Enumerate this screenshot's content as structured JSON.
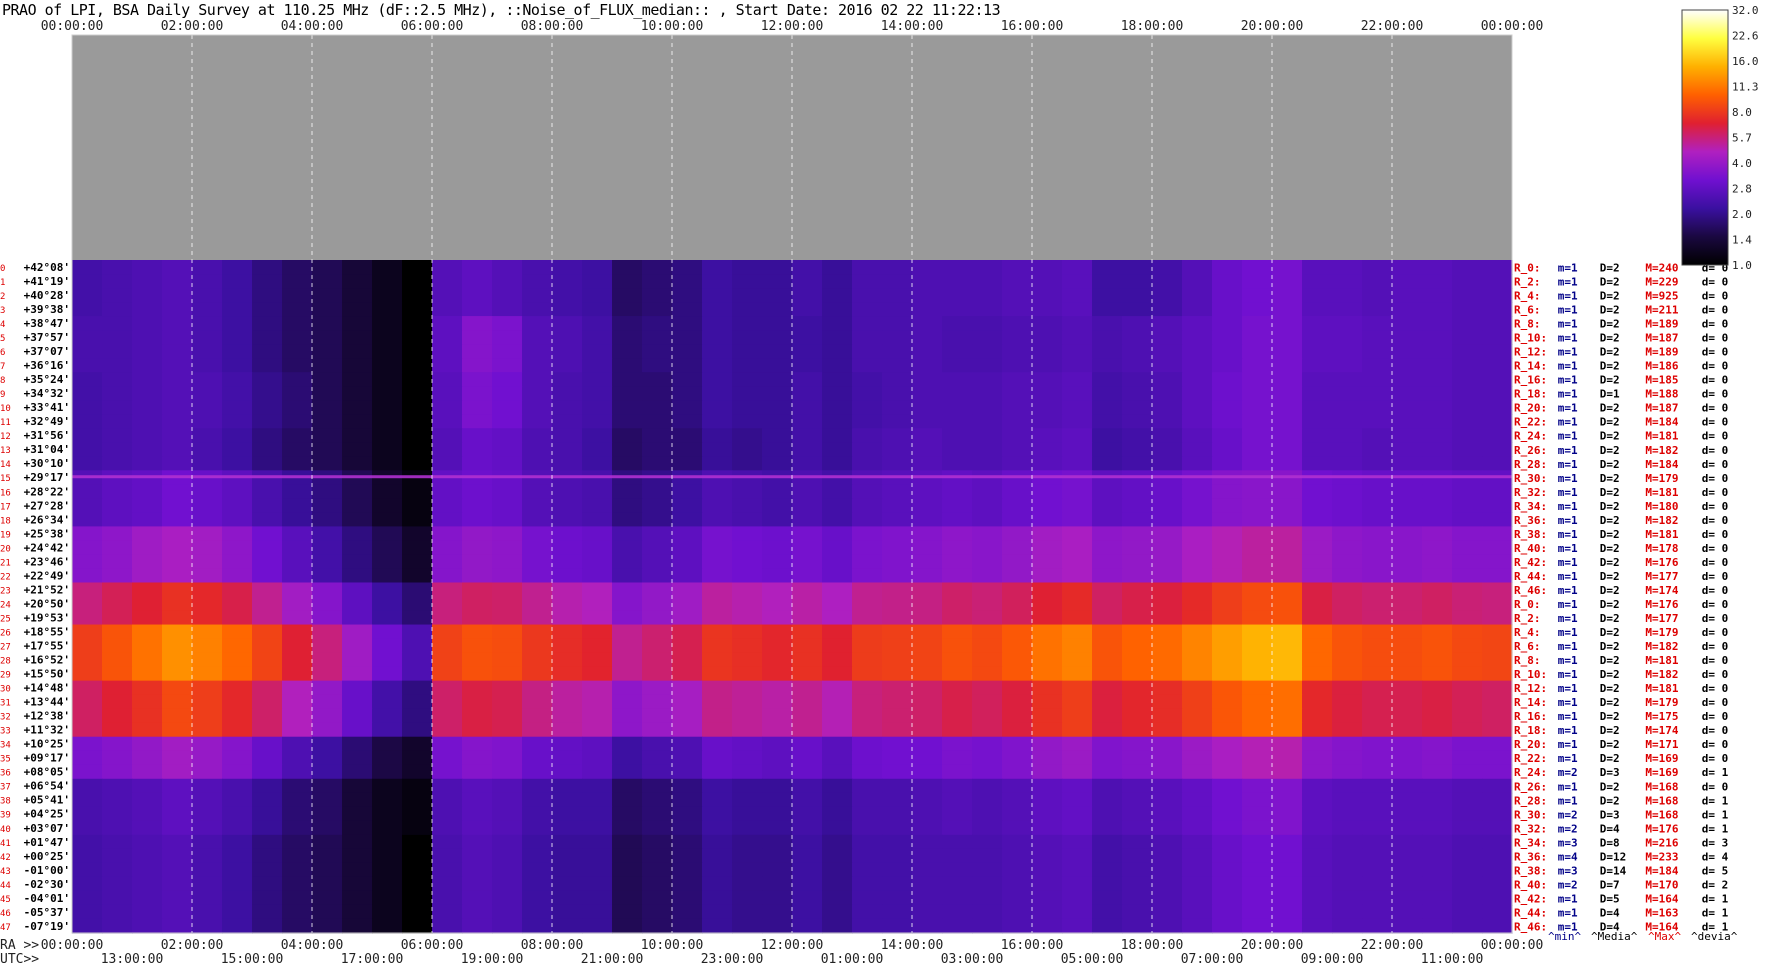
{
  "title": "PRAO of LPI, BSA Daily Survey at 110.25 MHz (dF::2.5 MHz), ::Noise_of_FLUX_median:: , Start Date: 2016 02 22 11:22:13",
  "chart_data": {
    "type": "heatmap",
    "title": "PRAO of LPI, BSA Daily Survey at 110.25 MHz (dF::2.5 MHz), ::Noise_of_FLUX_median:: , Start Date: 2016 02 22 11:22:13",
    "top_time_ticks": [
      "00:00:00",
      "02:00:00",
      "04:00:00",
      "06:00:00",
      "08:00:00",
      "10:00:00",
      "12:00:00",
      "14:00:00",
      "16:00:00",
      "18:00:00",
      "20:00:00",
      "22:00:00",
      "00:00:00"
    ],
    "ra_prefix": "RA >>",
    "ra_ticks": [
      "00:00:00",
      "02:00:00",
      "04:00:00",
      "06:00:00",
      "08:00:00",
      "10:00:00",
      "12:00:00",
      "14:00:00",
      "16:00:00",
      "18:00:00",
      "20:00:00",
      "22:00:00",
      "00:00:00"
    ],
    "utc_prefix": "UTC>>",
    "utc_ticks": [
      "13:00:00",
      "15:00:00",
      "17:00:00",
      "19:00:00",
      "21:00:00",
      "23:00:00",
      "01:00:00",
      "03:00:00",
      "05:00:00",
      "07:00:00",
      "09:00:00",
      "11:00:00"
    ],
    "declinations": [
      "+42°08'",
      "+41°19'",
      "+40°28'",
      "+39°38'",
      "+38°47'",
      "+37°57'",
      "+37°07'",
      "+36°16'",
      "+35°24'",
      "+34°32'",
      "+33°41'",
      "+32°49'",
      "+31°56'",
      "+31°04'",
      "+30°10'",
      "+29°17'",
      "+28°22'",
      "+27°28'",
      "+26°34'",
      "+25°38'",
      "+24°42'",
      "+23°46'",
      "+22°49'",
      "+21°52'",
      "+20°50'",
      "+19°53'",
      "+18°55'",
      "+17°55'",
      "+16°52'",
      "+15°50'",
      "+14°48'",
      "+13°44'",
      "+12°38'",
      "+11°32'",
      "+10°25'",
      "+09°17'",
      "+08°05'",
      "+06°54'",
      "+05°41'",
      "+04°25'",
      "+03°07'",
      "+01°47'",
      "+00°25'",
      "-01°00'",
      "-02°30'",
      "-04°01'",
      "-05°37'",
      "-07°19'"
    ],
    "beam_labels": [
      "0",
      "1",
      "2",
      "3",
      "4",
      "5",
      "6",
      "7",
      "8",
      "9",
      "10",
      "11",
      "12",
      "13",
      "14",
      "15",
      "16",
      "17",
      "18",
      "19",
      "20",
      "21",
      "22",
      "23",
      "24",
      "25",
      "26",
      "27",
      "28",
      "29",
      "30",
      "31",
      "32",
      "33",
      "34",
      "35",
      "36",
      "37",
      "38",
      "39",
      "40",
      "41",
      "42",
      "43",
      "44",
      "45",
      "46",
      "47"
    ],
    "row_stats": [
      {
        "r": "R_0:",
        "m": "m=1",
        "d": "D=2",
        "M": "M=240",
        "dv": "d= 0"
      },
      {
        "r": "R_2:",
        "m": "m=1",
        "d": "D=2",
        "M": "M=229",
        "dv": "d= 0"
      },
      {
        "r": "R_4:",
        "m": "m=1",
        "d": "D=2",
        "M": "M=925",
        "dv": "d= 0"
      },
      {
        "r": "R_6:",
        "m": "m=1",
        "d": "D=2",
        "M": "M=211",
        "dv": "d= 0"
      },
      {
        "r": "R_8:",
        "m": "m=1",
        "d": "D=2",
        "M": "M=189",
        "dv": "d= 0"
      },
      {
        "r": "R_10:",
        "m": "m=1",
        "d": "D=2",
        "M": "M=187",
        "dv": "d= 0"
      },
      {
        "r": "R_12:",
        "m": "m=1",
        "d": "D=2",
        "M": "M=189",
        "dv": "d= 0"
      },
      {
        "r": "R_14:",
        "m": "m=1",
        "d": "D=2",
        "M": "M=186",
        "dv": "d= 0"
      },
      {
        "r": "R_16:",
        "m": "m=1",
        "d": "D=2",
        "M": "M=185",
        "dv": "d= 0"
      },
      {
        "r": "R_18:",
        "m": "m=1",
        "d": "D=1",
        "M": "M=188",
        "dv": "d= 0"
      },
      {
        "r": "R_20:",
        "m": "m=1",
        "d": "D=2",
        "M": "M=187",
        "dv": "d= 0"
      },
      {
        "r": "R_22:",
        "m": "m=1",
        "d": "D=2",
        "M": "M=184",
        "dv": "d= 0"
      },
      {
        "r": "R_24:",
        "m": "m=1",
        "d": "D=2",
        "M": "M=181",
        "dv": "d= 0"
      },
      {
        "r": "R_26:",
        "m": "m=1",
        "d": "D=2",
        "M": "M=182",
        "dv": "d= 0"
      },
      {
        "r": "R_28:",
        "m": "m=1",
        "d": "D=2",
        "M": "M=184",
        "dv": "d= 0"
      },
      {
        "r": "R_30:",
        "m": "m=1",
        "d": "D=2",
        "M": "M=179",
        "dv": "d= 0"
      },
      {
        "r": "R_32:",
        "m": "m=1",
        "d": "D=2",
        "M": "M=181",
        "dv": "d= 0"
      },
      {
        "r": "R_34:",
        "m": "m=1",
        "d": "D=2",
        "M": "M=180",
        "dv": "d= 0"
      },
      {
        "r": "R_36:",
        "m": "m=1",
        "d": "D=2",
        "M": "M=182",
        "dv": "d= 0"
      },
      {
        "r": "R_38:",
        "m": "m=1",
        "d": "D=2",
        "M": "M=181",
        "dv": "d= 0"
      },
      {
        "r": "R_40:",
        "m": "m=1",
        "d": "D=2",
        "M": "M=178",
        "dv": "d= 0"
      },
      {
        "r": "R_42:",
        "m": "m=1",
        "d": "D=2",
        "M": "M=176",
        "dv": "d= 0"
      },
      {
        "r": "R_44:",
        "m": "m=1",
        "d": "D=2",
        "M": "M=177",
        "dv": "d= 0"
      },
      {
        "r": "R_46:",
        "m": "m=1",
        "d": "D=2",
        "M": "M=174",
        "dv": "d= 0"
      },
      {
        "r": "R_0:",
        "m": "m=1",
        "d": "D=2",
        "M": "M=176",
        "dv": "d= 0"
      },
      {
        "r": "R_2:",
        "m": "m=1",
        "d": "D=2",
        "M": "M=177",
        "dv": "d= 0"
      },
      {
        "r": "R_4:",
        "m": "m=1",
        "d": "D=2",
        "M": "M=179",
        "dv": "d= 0"
      },
      {
        "r": "R_6:",
        "m": "m=1",
        "d": "D=2",
        "M": "M=182",
        "dv": "d= 0"
      },
      {
        "r": "R_8:",
        "m": "m=1",
        "d": "D=2",
        "M": "M=181",
        "dv": "d= 0"
      },
      {
        "r": "R_10:",
        "m": "m=1",
        "d": "D=2",
        "M": "M=182",
        "dv": "d= 0"
      },
      {
        "r": "R_12:",
        "m": "m=1",
        "d": "D=2",
        "M": "M=181",
        "dv": "d= 0"
      },
      {
        "r": "R_14:",
        "m": "m=1",
        "d": "D=2",
        "M": "M=179",
        "dv": "d= 0"
      },
      {
        "r": "R_16:",
        "m": "m=1",
        "d": "D=2",
        "M": "M=175",
        "dv": "d= 0"
      },
      {
        "r": "R_18:",
        "m": "m=1",
        "d": "D=2",
        "M": "M=174",
        "dv": "d= 0"
      },
      {
        "r": "R_20:",
        "m": "m=1",
        "d": "D=2",
        "M": "M=171",
        "dv": "d= 0"
      },
      {
        "r": "R_22:",
        "m": "m=1",
        "d": "D=2",
        "M": "M=169",
        "dv": "d= 0"
      },
      {
        "r": "R_24:",
        "m": "m=2",
        "d": "D=3",
        "M": "M=169",
        "dv": "d= 1"
      },
      {
        "r": "R_26:",
        "m": "m=1",
        "d": "D=2",
        "M": "M=168",
        "dv": "d= 0"
      },
      {
        "r": "R_28:",
        "m": "m=1",
        "d": "D=2",
        "M": "M=168",
        "dv": "d= 1"
      },
      {
        "r": "R_30:",
        "m": "m=2",
        "d": "D=3",
        "M": "M=168",
        "dv": "d= 1"
      },
      {
        "r": "R_32:",
        "m": "m=2",
        "d": "D=4",
        "M": "M=176",
        "dv": "d= 1"
      },
      {
        "r": "R_34:",
        "m": "m=3",
        "d": "D=8",
        "M": "M=216",
        "dv": "d= 3"
      },
      {
        "r": "R_36:",
        "m": "m=4",
        "d": "D=12",
        "M": "M=233",
        "dv": "d= 4"
      },
      {
        "r": "R_38:",
        "m": "m=3",
        "d": "D=14",
        "M": "M=184",
        "dv": "d= 5"
      },
      {
        "r": "R_40:",
        "m": "m=2",
        "d": "D=7",
        "M": "M=170",
        "dv": "d= 2"
      },
      {
        "r": "R_42:",
        "m": "m=1",
        "d": "D=5",
        "M": "M=164",
        "dv": "d= 1"
      },
      {
        "r": "R_44:",
        "m": "m=1",
        "d": "D=4",
        "M": "M=163",
        "dv": "d= 1"
      },
      {
        "r": "R_46:",
        "m": "m=1",
        "d": "D=4",
        "M": "M=164",
        "dv": "d= 1"
      }
    ],
    "stats_legend": [
      "^min^",
      "^Media^",
      "^Max^",
      "^devia^"
    ],
    "colorbar_ticks": [
      "32.0",
      "22.6",
      "16.0",
      "11.3",
      "8.0",
      "5.7",
      "4.0",
      "2.8",
      "2.0",
      "1.4",
      "1.0"
    ],
    "colorbar_range": [
      1.0,
      32.0
    ],
    "colorbar_scale": "log",
    "colormap_stops": [
      "#000000",
      "#1a0840",
      "#3a10a0",
      "#7010d0",
      "#b020c0",
      "#e02030",
      "#ff6000",
      "#ffb000",
      "#ffff40",
      "#ffffff"
    ],
    "hour_band_levels": [
      [
        2.3,
        2.4,
        2.5,
        2.6,
        2.4,
        2.2,
        1.9,
        1.7,
        1.6,
        1.4,
        1.2,
        1.0,
        2.6,
        2.8,
        2.6,
        2.4,
        2.3,
        2.2,
        1.7,
        1.8,
        1.9,
        2.2,
        2.1,
        2.1,
        2.3,
        2.1,
        2.4,
        2.4,
        2.5,
        2.5,
        2.5,
        2.6,
        2.6,
        2.7,
        2.2,
        2.2,
        2.3,
        2.6,
        3.0,
        3.2,
        3.3,
        2.7,
        2.7,
        2.6,
        2.7,
        2.7,
        2.6,
        2.6
      ],
      [
        2.4,
        2.4,
        2.5,
        2.6,
        2.4,
        2.2,
        1.9,
        1.7,
        1.6,
        1.4,
        1.2,
        1.0,
        2.8,
        3.6,
        3.4,
        2.6,
        2.5,
        2.3,
        1.8,
        1.9,
        1.9,
        2.2,
        2.1,
        2.1,
        2.2,
        2.1,
        2.4,
        2.4,
        2.5,
        2.4,
        2.4,
        2.5,
        2.5,
        2.6,
        2.4,
        2.5,
        2.6,
        2.8,
        3.0,
        3.3,
        3.3,
        2.8,
        2.8,
        2.7,
        2.7,
        2.7,
        2.6,
        2.6
      ],
      [
        2.3,
        2.4,
        2.5,
        2.6,
        2.5,
        2.3,
        2.0,
        1.8,
        1.6,
        1.4,
        1.2,
        1.0,
        2.7,
        3.4,
        3.2,
        2.6,
        2.4,
        2.3,
        1.8,
        1.8,
        1.9,
        2.2,
        2.1,
        2.1,
        2.3,
        2.1,
        2.3,
        2.4,
        2.5,
        2.5,
        2.5,
        2.6,
        2.6,
        2.7,
        2.3,
        2.4,
        2.5,
        2.8,
        3.1,
        3.3,
        3.3,
        2.7,
        2.7,
        2.7,
        2.7,
        2.7,
        2.6,
        2.6
      ],
      [
        2.3,
        2.4,
        2.5,
        2.6,
        2.4,
        2.2,
        1.9,
        1.7,
        1.6,
        1.4,
        1.2,
        1.0,
        2.6,
        3.0,
        2.9,
        2.5,
        2.4,
        2.2,
        1.7,
        1.8,
        1.8,
        2.1,
        2.0,
        2.1,
        2.3,
        2.1,
        2.4,
        2.5,
        2.6,
        2.5,
        2.5,
        2.6,
        2.7,
        2.8,
        2.2,
        2.3,
        2.4,
        2.7,
        3.0,
        3.3,
        3.3,
        2.7,
        2.7,
        2.6,
        2.7,
        2.7,
        2.6,
        2.6
      ],
      [
        2.6,
        2.8,
        2.9,
        3.2,
        3.0,
        2.8,
        2.4,
        2.1,
        1.9,
        1.6,
        1.3,
        1.1,
        2.9,
        3.1,
        3.0,
        2.6,
        2.5,
        2.4,
        1.9,
        2.0,
        2.2,
        2.5,
        2.4,
        2.3,
        2.5,
        2.3,
        2.6,
        2.7,
        2.8,
        2.9,
        2.8,
        3.0,
        3.2,
        3.3,
        2.8,
        2.9,
        3.0,
        3.3,
        3.6,
        3.7,
        3.7,
        3.2,
        3.1,
        3.0,
        3.0,
        3.0,
        2.9,
        2.9
      ],
      [
        3.6,
        3.8,
        4.2,
        4.5,
        4.3,
        3.8,
        3.2,
        2.7,
        2.3,
        1.9,
        1.6,
        1.3,
        3.6,
        3.9,
        3.8,
        3.3,
        3.1,
        3.0,
        2.4,
        2.6,
        2.8,
        3.3,
        3.2,
        3.1,
        3.3,
        3.0,
        3.4,
        3.5,
        3.6,
        3.8,
        3.7,
        3.9,
        4.3,
        4.5,
        3.8,
        3.9,
        4.0,
        4.5,
        4.8,
        5.1,
        5.1,
        4.1,
        3.8,
        3.7,
        3.7,
        3.8,
        3.6,
        3.6
      ],
      [
        5.6,
        6.2,
        6.8,
        7.6,
        7.2,
        6.4,
        5.3,
        4.3,
        3.6,
        2.8,
        2.2,
        1.8,
        5.6,
        6.0,
        5.9,
        5.3,
        4.9,
        4.7,
        3.6,
        3.9,
        4.2,
        5.1,
        4.9,
        4.7,
        5.0,
        4.6,
        5.3,
        5.4,
        5.5,
        5.9,
        5.7,
        6.1,
        6.8,
        7.3,
        6.0,
        6.4,
        6.6,
        7.3,
        8.2,
        8.9,
        9.2,
        6.5,
        6.0,
        5.8,
        5.8,
        6.0,
        5.7,
        5.6
      ],
      [
        8.2,
        9.4,
        11.0,
        12.7,
        11.8,
        10.4,
        8.5,
        6.8,
        5.6,
        4.2,
        3.2,
        2.5,
        8.4,
        9.2,
        9.0,
        7.9,
        7.4,
        7.0,
        5.3,
        5.8,
        6.3,
        7.8,
        7.5,
        7.1,
        7.6,
        6.9,
        8.1,
        8.3,
        8.5,
        9.2,
        8.8,
        9.6,
        11.0,
        11.8,
        9.4,
        10.2,
        10.6,
        12.0,
        13.6,
        15.0,
        15.4,
        10.4,
        9.4,
        9.0,
        9.0,
        9.3,
        8.8,
        8.6
      ],
      [
        6.0,
        6.8,
        7.6,
        8.8,
        8.2,
        7.2,
        5.9,
        4.7,
        3.9,
        3.0,
        2.3,
        1.9,
        5.9,
        6.5,
        6.3,
        5.5,
        5.1,
        4.9,
        3.8,
        4.1,
        4.4,
        5.4,
        5.2,
        5.0,
        5.3,
        4.8,
        5.6,
        5.8,
        5.9,
        6.4,
        6.1,
        6.6,
        7.6,
        8.2,
        6.6,
        7.1,
        7.4,
        8.3,
        9.5,
        10.4,
        10.8,
        7.2,
        6.6,
        6.3,
        6.3,
        6.5,
        6.2,
        6.0
      ],
      [
        3.4,
        3.6,
        3.9,
        4.3,
        4.0,
        3.6,
        3.0,
        2.5,
        2.2,
        1.8,
        1.5,
        1.3,
        3.3,
        3.6,
        3.5,
        3.0,
        2.9,
        2.8,
        2.2,
        2.4,
        2.5,
        3.0,
        2.9,
        2.8,
        3.0,
        2.7,
        3.1,
        3.2,
        3.2,
        3.4,
        3.3,
        3.5,
        3.9,
        4.1,
        3.5,
        3.6,
        3.7,
        4.1,
        4.5,
        4.8,
        4.9,
        3.8,
        3.6,
        3.5,
        3.5,
        3.6,
        3.4,
        3.4
      ],
      [
        2.4,
        2.5,
        2.6,
        2.8,
        2.6,
        2.4,
        2.1,
        1.8,
        1.7,
        1.4,
        1.2,
        1.1,
        2.5,
        2.7,
        2.6,
        2.3,
        2.2,
        2.2,
        1.7,
        1.8,
        1.9,
        2.2,
        2.1,
        2.1,
        2.3,
        2.1,
        2.4,
        2.4,
        2.5,
        2.6,
        2.5,
        2.6,
        2.8,
        2.9,
        2.5,
        2.6,
        2.7,
        2.9,
        3.2,
        3.4,
        3.5,
        2.8,
        2.7,
        2.7,
        2.7,
        2.7,
        2.6,
        2.6
      ],
      [
        2.3,
        2.4,
        2.5,
        2.6,
        2.4,
        2.2,
        1.9,
        1.7,
        1.6,
        1.4,
        1.2,
        1.0,
        2.4,
        2.6,
        2.5,
        2.2,
        2.1,
        2.1,
        1.6,
        1.7,
        1.8,
        2.1,
        2.0,
        2.0,
        2.2,
        2.0,
        2.3,
        2.3,
        2.4,
        2.4,
        2.4,
        2.5,
        2.6,
        2.7,
        2.3,
        2.4,
        2.5,
        2.7,
        3.0,
        3.2,
        3.2,
        2.7,
        2.6,
        2.6,
        2.6,
        2.6,
        2.5,
        2.5
      ],
      [
        2.3,
        2.4,
        2.5,
        2.6,
        2.4,
        2.2,
        1.9,
        1.7,
        1.6,
        1.4,
        1.2,
        1.0,
        2.4,
        2.6,
        2.5,
        2.2,
        2.1,
        2.1,
        1.6,
        1.7,
        1.8,
        2.1,
        2.0,
        2.0,
        2.2,
        2.0,
        2.3,
        2.3,
        2.4,
        2.4,
        2.4,
        2.5,
        2.6,
        2.7,
        2.3,
        2.4,
        2.5,
        2.7,
        3.0,
        3.2,
        3.2,
        2.7,
        2.6,
        2.6,
        2.6,
        2.6,
        2.5,
        2.5
      ]
    ]
  }
}
